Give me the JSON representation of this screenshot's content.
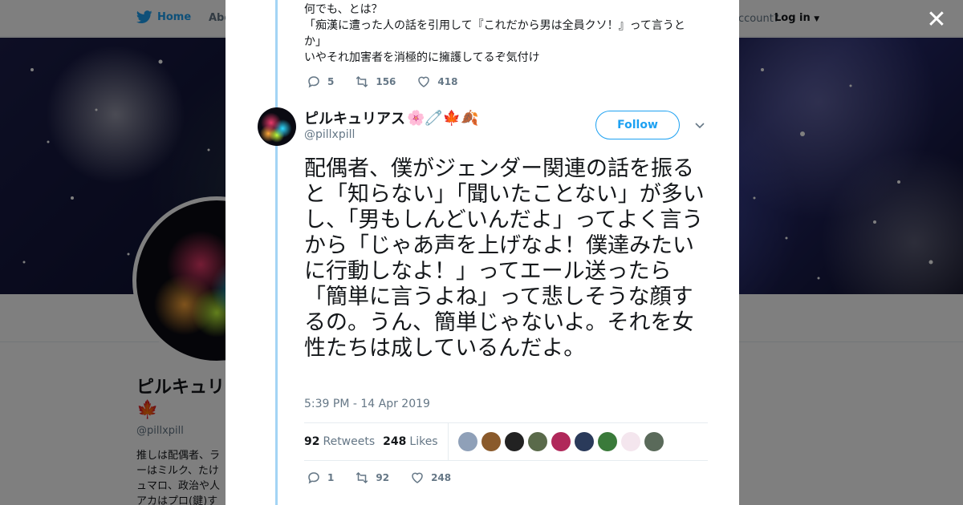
{
  "nav": {
    "home_label": "Home",
    "about_label": "About",
    "account_prompt": "ccount?",
    "login_label": "Log in"
  },
  "profile": {
    "name": "ピルキュリアス🌸🧷🍁",
    "handle": "@pillxpill",
    "bio": "推しは配偶者、ラ\nーはミルク、たけ\nュマロ、政治や人\nアカはプロ(鍵)す"
  },
  "previous_tweet": {
    "lines": [
      "何でも、とは？",
      "「痴漢に遭った人の話を引用して『これだから男は全員クソ！』って言うとか」",
      "いやそれ加害者を消極的に擁護してるぞ気付け"
    ],
    "replies": "5",
    "retweets": "156",
    "likes": "418"
  },
  "tweet": {
    "name": "ピルキュリアス",
    "name_emoji": "🌸🧷🍁🍂",
    "handle": "@pillxpill",
    "follow_label": "Follow",
    "text": "配偶者、僕がジェンダー関連の話を振ると「知らない」「聞いたことない」が多いし、「男もしんどいんだよ」ってよく言うから「じゃあ声を上げなよ！僕達みたいに行動しなよ！」ってエール送ったら「簡単に言うよね」って悲しそうな顔するの。うん、簡単じゃないよ。それを女性たちは成しているんだよ。",
    "timestamp": "5:39 PM - 14 Apr 2019",
    "retweets_count": "92",
    "retweets_label": "Retweets",
    "likes_count": "248",
    "likes_label": "Likes",
    "replies": "1",
    "retweets": "92",
    "likes": "248"
  },
  "liker_colors": [
    "#8fa0b8",
    "#8a5a2b",
    "#222222",
    "#5a6a4a",
    "#b0285a",
    "#2a3a5a",
    "#3a7a3a",
    "#f4e6ee",
    "#5a6a5a"
  ],
  "colors": {
    "accent": "#1da1f2",
    "thread_line": "#a3d4f5",
    "muted": "#657786",
    "text": "#14171a"
  },
  "icons": {
    "close": "close-icon",
    "reply": "reply-icon",
    "retweet": "retweet-icon",
    "like": "heart-icon",
    "bird": "twitter-bird-icon",
    "caret": "chevron-down-icon"
  }
}
